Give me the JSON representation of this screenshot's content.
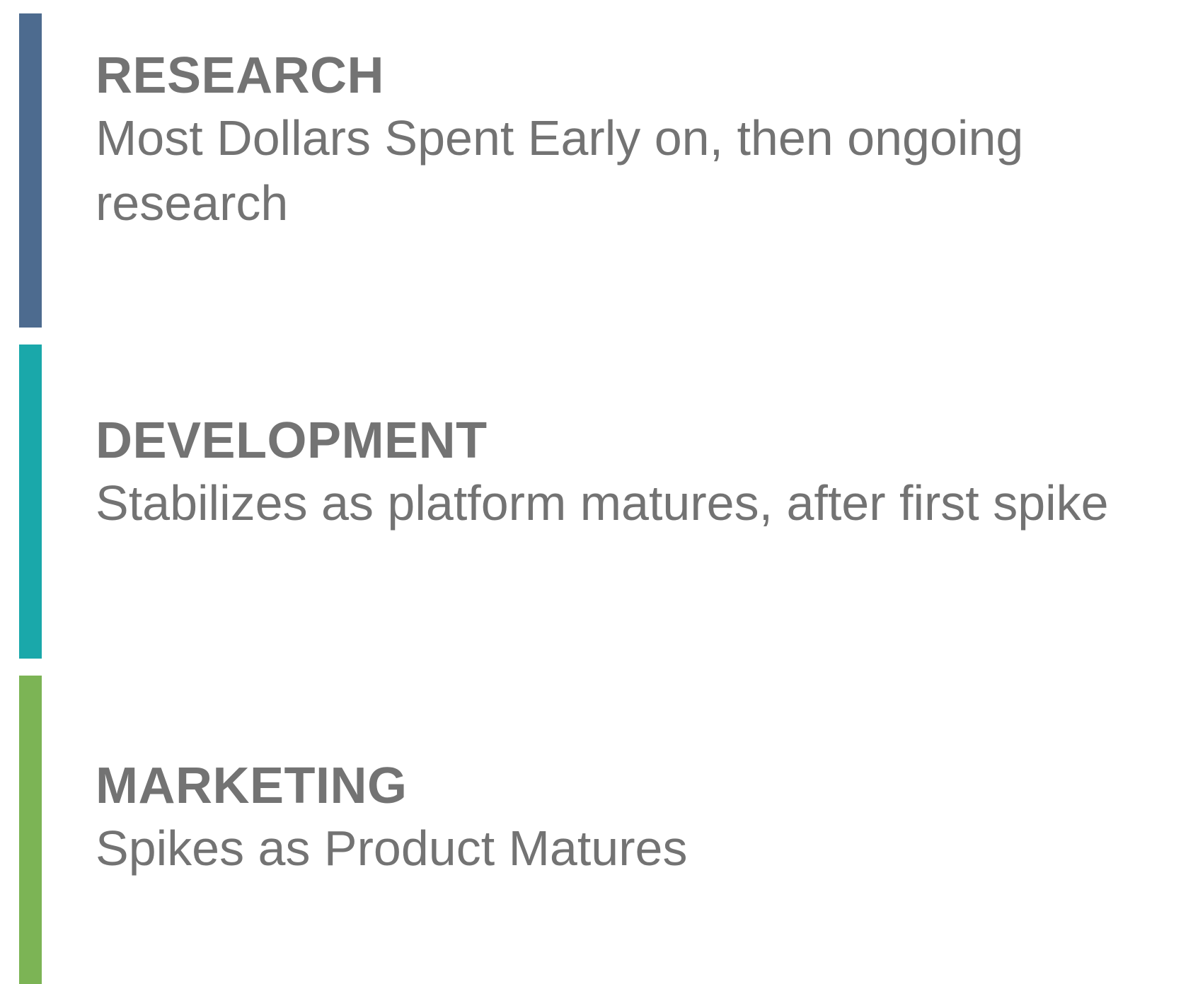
{
  "sections": [
    {
      "heading": "RESEARCH",
      "description": "Most Dollars Spent Early on, then ongoing research",
      "color": "#4d6b8f"
    },
    {
      "heading": "DEVELOPMENT",
      "description": "Stabilizes as platform matures, after first spike",
      "color": "#1aa8aa"
    },
    {
      "heading": "MARKETING",
      "description": "Spikes as Product Matures",
      "color": "#7cb455"
    }
  ]
}
